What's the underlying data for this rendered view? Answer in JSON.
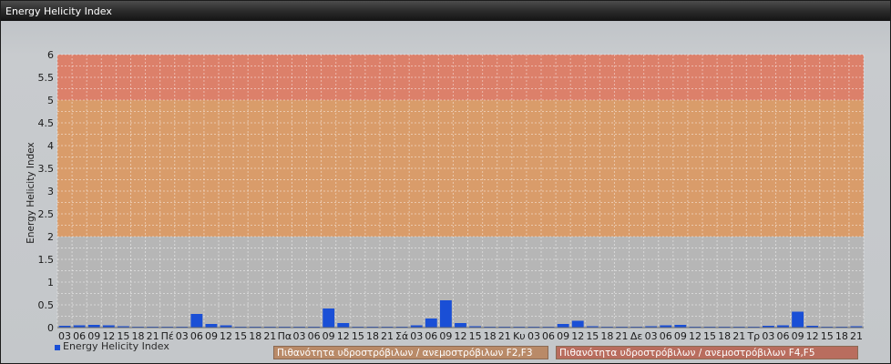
{
  "window": {
    "title": "Energy Helicity Index"
  },
  "chart_data": {
    "type": "bar",
    "title": "Energy Helicity Index",
    "ylabel": "Energy Helicity Index",
    "xlabel": "",
    "ylim": [
      0,
      6
    ],
    "yticks": [
      "0",
      "0.5",
      "1",
      "1.5",
      "2",
      "2.5",
      "3",
      "3.5",
      "4",
      "4.5",
      "5",
      "5.5",
      "6"
    ],
    "grid": true,
    "categories": [
      "03",
      "06",
      "09",
      "12",
      "15",
      "18",
      "21",
      "Πέ",
      "03",
      "06",
      "09",
      "12",
      "15",
      "18",
      "21",
      "Πα",
      "03",
      "06",
      "09",
      "12",
      "15",
      "18",
      "21",
      "Σά",
      "03",
      "06",
      "09",
      "12",
      "15",
      "18",
      "21",
      "Κυ",
      "03",
      "06",
      "09",
      "12",
      "15",
      "18",
      "21",
      "Δε",
      "03",
      "06",
      "09",
      "12",
      "15",
      "18",
      "21",
      "Τρ",
      "03",
      "06",
      "09",
      "12",
      "15",
      "18",
      "21"
    ],
    "series": [
      {
        "name": "Energy Helicity Index",
        "color": "#1a4fd6",
        "values": [
          0.04,
          0.05,
          0.06,
          0.05,
          0.03,
          0.02,
          0.02,
          0.02,
          0.02,
          0.3,
          0.08,
          0.05,
          0.02,
          0.02,
          0.02,
          0.02,
          0.02,
          0.02,
          0.42,
          0.1,
          0.02,
          0.02,
          0.02,
          0.02,
          0.05,
          0.2,
          0.6,
          0.1,
          0.03,
          0.02,
          0.02,
          0.02,
          0.02,
          0.02,
          0.08,
          0.15,
          0.03,
          0.02,
          0.02,
          0.02,
          0.03,
          0.05,
          0.06,
          0.02,
          0.02,
          0.02,
          0.02,
          0.02,
          0.04,
          0.05,
          0.35,
          0.04,
          0.02,
          0.02,
          0.03
        ]
      }
    ],
    "bands": [
      {
        "from": 0,
        "to": 2,
        "color": "#b6b6b6"
      },
      {
        "from": 2,
        "to": 5,
        "color": "#d99c6a",
        "label": "Πιθανότητα υδροστρόβιλων / ανεμοστρόβιλων F2,F3"
      },
      {
        "from": 5,
        "to": 6,
        "color": "#dc806a",
        "label": "Πιθανότητα υδροστρόβιλων / ανεμοστρόβιλων F4,F5"
      }
    ],
    "legend": [
      {
        "label": "Energy Helicity Index",
        "color": "#1a4fd6"
      }
    ],
    "band_legend": [
      {
        "label": "Πιθανότητα υδροστρόβιλων / ανεμοστρόβιλων F2,F3",
        "color": "#b98a68"
      },
      {
        "label": "Πιθανότητα υδροστρόβιλων / ανεμοστρόβιλων F4,F5",
        "color": "#b96d5e"
      }
    ]
  }
}
